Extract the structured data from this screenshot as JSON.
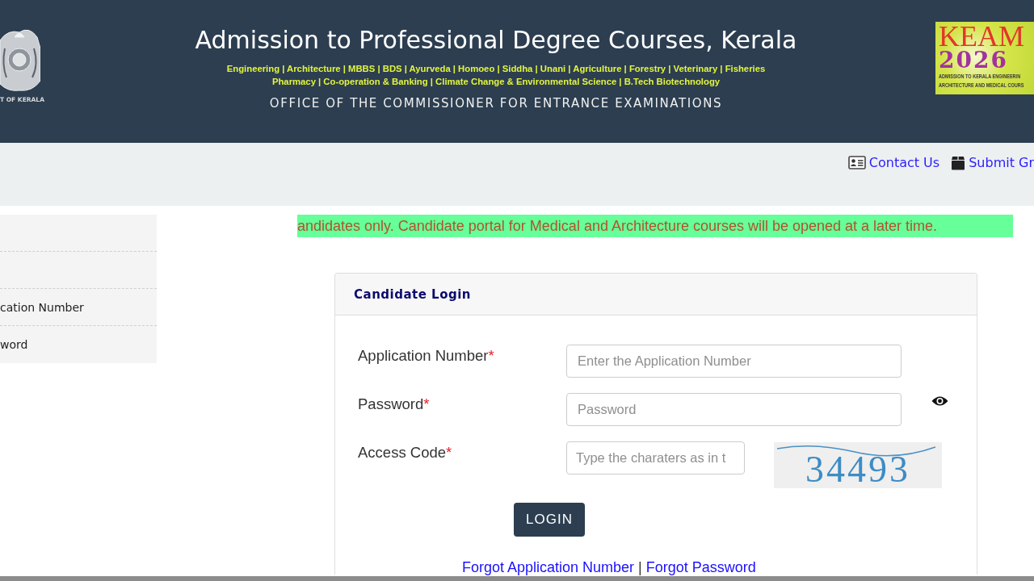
{
  "header": {
    "emblem_caption": "T OF KERALA",
    "title": "Admission to Professional Degree Courses, Kerala",
    "course_lines": [
      "Engineering | Architecture | MBBS | BDS | Ayurveda | Homoeo | Siddha | Unani | Agriculture | Forestry | Veterinary | Fisheries",
      "Pharmacy | Co-operation & Banking | Climate Change & Environmental Science | B.Tech Biotechnology"
    ],
    "office": "OFFICE OF THE COMMISSIONER FOR ENTRANCE EXAMINATIONS",
    "logo": {
      "name": "KEAM",
      "year": "2026",
      "lines": [
        "ADMISSION TO KERALA ENGINEERIN",
        "ARCHITECTURE AND MEDICAL COURS"
      ]
    }
  },
  "nav_links": [
    {
      "label": "Contact Us"
    },
    {
      "label": "Submit Gr"
    }
  ],
  "sidebar": {
    "items": [
      {
        "kind": "blank"
      },
      {
        "kind": "blank"
      },
      {
        "kind": "link",
        "label": "cation Number"
      },
      {
        "kind": "link",
        "label": "word"
      }
    ]
  },
  "notice": "andidates only. Candidate portal for Medical and Architecture courses will be opened at a later time.",
  "login_card": {
    "title": "Candidate Login",
    "fields": [
      {
        "kind": "text",
        "label": "Application Number",
        "required_mark": "*",
        "placeholder": "Enter the Application Number"
      },
      {
        "kind": "password",
        "label": "Password",
        "required_mark": "*",
        "placeholder": "Password"
      },
      {
        "kind": "captcha",
        "label": "Access Code",
        "required_mark": "*",
        "placeholder": "Type the charaters as in t",
        "captcha_text": "34493"
      }
    ],
    "submit": "LOGIN",
    "links": [
      "Forgot Application Number",
      "Forgot Password"
    ],
    "link_separator": "|"
  }
}
